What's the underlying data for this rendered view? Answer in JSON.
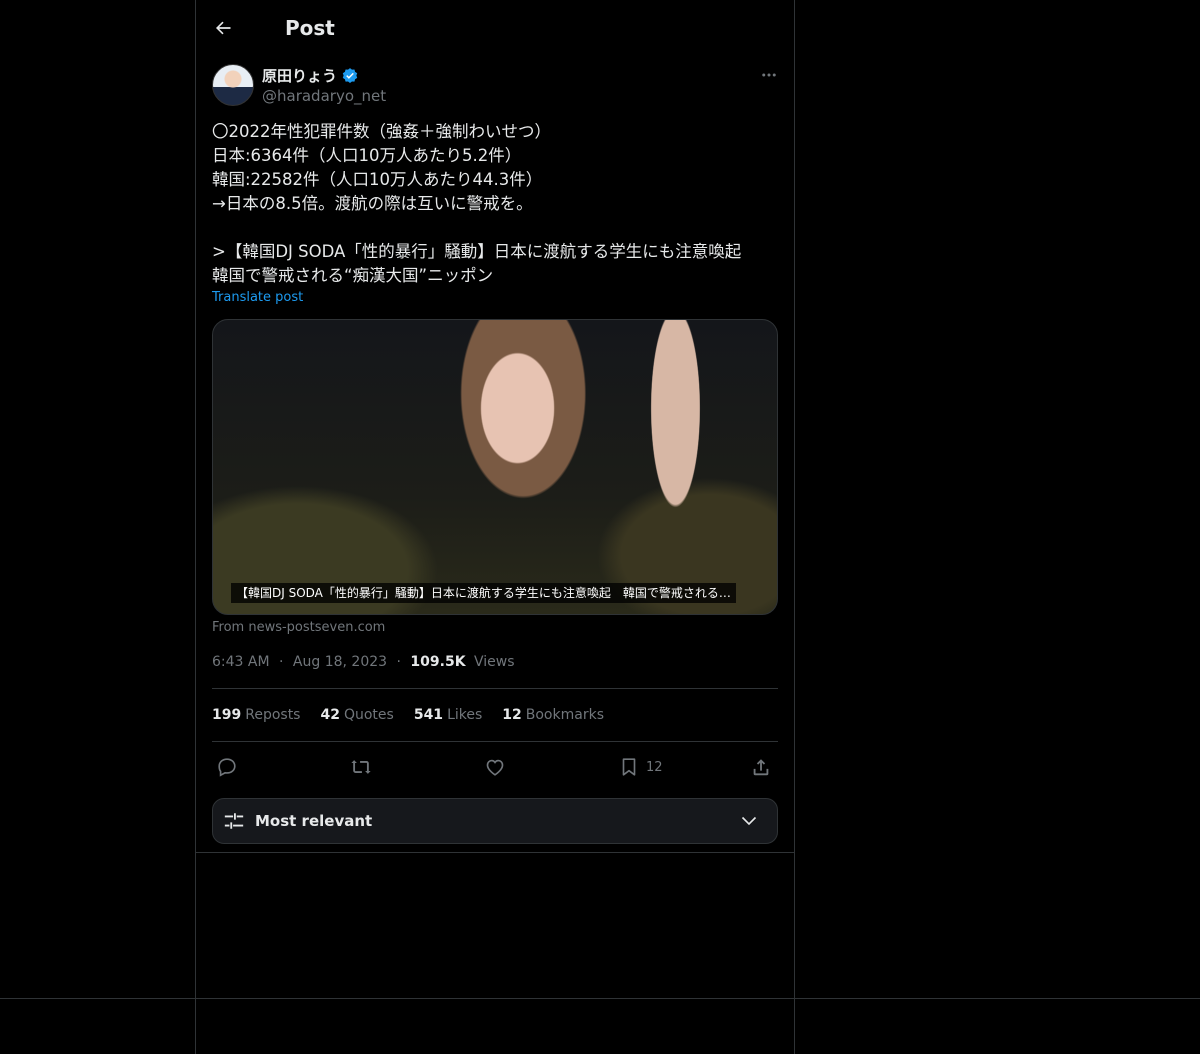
{
  "header": {
    "title": "Post"
  },
  "author": {
    "display_name": "原田りょう",
    "handle": "@haradaryo_net",
    "verified": true
  },
  "post": {
    "text": "〇2022年性犯罪件数（強姦＋強制わいせつ）\n日本:6364件（人口10万人あたり5.2件）\n韓国:22582件（人口10万人あたり44.3件）\n→日本の8.5倍。渡航の際は互いに警戒を。\n\n>【韓国DJ SODA「性的暴行」騒動】日本に渡航する学生にも注意喚起\n韓国で警戒される“痴漢大国”ニッポン",
    "translate_label": "Translate post"
  },
  "media": {
    "caption": "【韓国DJ SODA「性的暴行」騒動】日本に渡航する学生にも注意喚起　韓国で警戒される…",
    "source": "From news-postseven.com"
  },
  "meta": {
    "time": "6:43 AM",
    "date": "Aug 18, 2023",
    "views_count": "109.5K",
    "views_label": "Views",
    "sep": "·"
  },
  "stats": [
    {
      "count": "199",
      "label": "Reposts"
    },
    {
      "count": "42",
      "label": "Quotes"
    },
    {
      "count": "541",
      "label": "Likes"
    },
    {
      "count": "12",
      "label": "Bookmarks"
    }
  ],
  "actions": {
    "bookmark_count": "12"
  },
  "sort": {
    "label": "Most relevant"
  },
  "colors": {
    "background": "#000000",
    "text": "#e7e9ea",
    "muted": "#71767b",
    "accent": "#1d9bf0",
    "border": "#2f3336",
    "verified": "#1d9bf0"
  },
  "icons": [
    "back-arrow-icon",
    "verified-badge-icon",
    "more-icon",
    "reply-icon",
    "repost-icon",
    "like-icon",
    "bookmark-icon",
    "share-icon",
    "sliders-icon",
    "chevron-down-icon"
  ]
}
